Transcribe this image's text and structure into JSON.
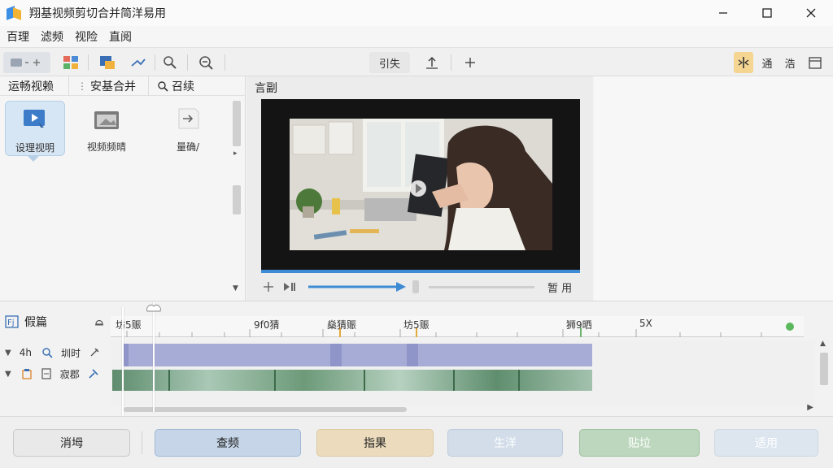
{
  "app": {
    "title": "翔基视频剪切合并简洋易用"
  },
  "menu": [
    "百理",
    "滤频",
    "视险",
    "直阅"
  ],
  "toolbar": {
    "center_label": "引失",
    "right_labels": [
      "通",
      "浩"
    ]
  },
  "left_panel": {
    "tabs": [
      "运畅视赖",
      "安基合并",
      "召续"
    ],
    "items": [
      {
        "label": "设理视明",
        "icon": "video-file-icon",
        "selected": true
      },
      {
        "label": "视频频晴",
        "icon": "folder-icon",
        "selected": false
      },
      {
        "label": "量确/",
        "icon": "arrow-doc-icon",
        "selected": false
      }
    ]
  },
  "preview": {
    "title": "言副",
    "right_label": "暂 用"
  },
  "timeline": {
    "header_label": "假篇",
    "ruler_labels": [
      "坊5赈",
      "9f0猜",
      "燊猜赈",
      "坊5赈",
      "狮9晒",
      "5X"
    ],
    "tracks": [
      {
        "name": "圳时",
        "prefix": "4h"
      },
      {
        "name": "寂郡",
        "prefix": ""
      }
    ]
  },
  "bottom_buttons": [
    "消坶",
    "查频",
    "指果",
    "生洋",
    "贴垃",
    "适用"
  ],
  "colors": {
    "accent_blue": "#3d8bd4",
    "clip_blue": "#a6acd6",
    "video_green": "#6d9a79"
  }
}
